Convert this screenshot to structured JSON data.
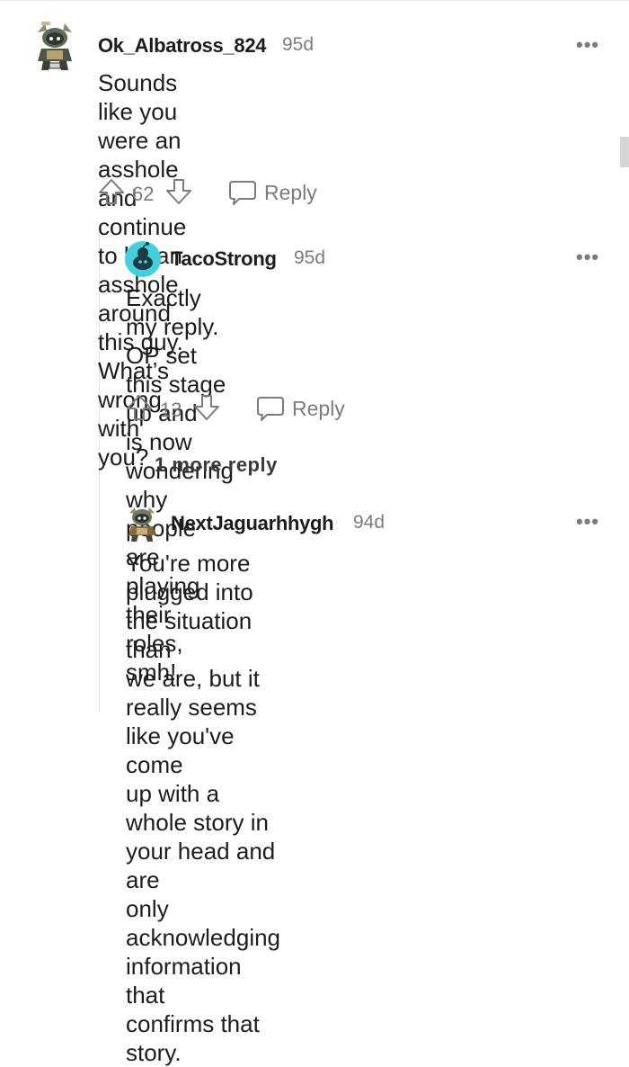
{
  "comments": [
    {
      "author": "Ok_Albatross_824",
      "age": "95d",
      "more": "•••",
      "lines": [
        "Sounds like you were an asshole and continue",
        "to be an asshole around this guy. What’s",
        "wrong with you?"
      ],
      "score": "62",
      "reply_label": "Reply",
      "avatar_icon": "snoo-armored-avatar-icon"
    },
    {
      "author": "TacoStrong",
      "age": "95d",
      "more": "•••",
      "lines": [
        "Exactly my reply. OP set this stage up and",
        "is now wondering why people are playing",
        "their roles, smh!"
      ],
      "score": "13",
      "reply_label": "Reply",
      "avatar_icon": "default-snoo-avatar-icon"
    },
    {
      "author": "NextJaguarhhygh",
      "age": "94d",
      "more": "•••",
      "lines": [
        "You're more plugged into the situation than",
        "we are, but it really seems like you've come",
        "up with a whole story in your head and are",
        "only acknowledging information that",
        "confirms that story."
      ],
      "avatar_icon": "snoo-warrior-avatar-icon"
    }
  ],
  "more_replies_label": "1 more reply",
  "colors": {
    "text": "#1c1c1c",
    "muted": "#7c7c7c",
    "thread_line": "#e2e2e2",
    "default_avatar": "#3fd1e0"
  }
}
